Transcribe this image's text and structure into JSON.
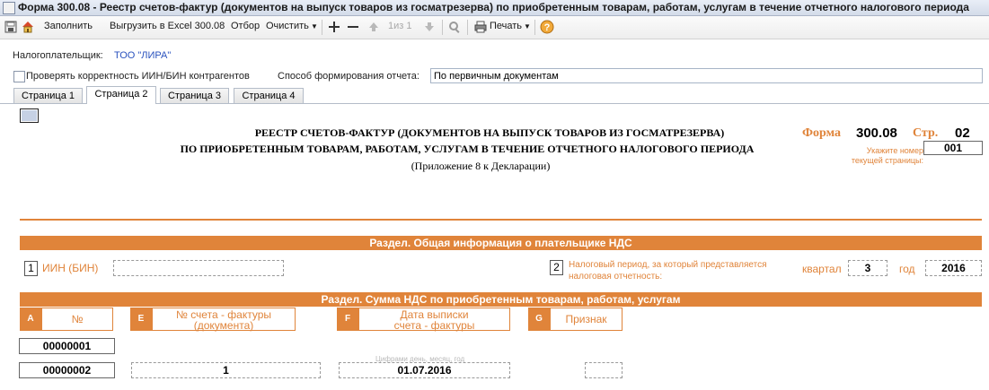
{
  "window": {
    "title": "Форма 300.08 - Реестр счетов-фактур (документов на выпуск товаров из госматрезерва) по приобретенным товарам, работам, услугам в течение отчетного налогового периода"
  },
  "toolbar": {
    "fill": "Заполнить",
    "export": "Выгрузить в Excel 300.08",
    "filter": "Отбор",
    "clear": "Очистить",
    "page_counter": "1из 1",
    "print": "Печать"
  },
  "header": {
    "taxpayer_label": "Налогоплательщик:",
    "taxpayer_value": "ТОО \"ЛИРА\"",
    "check_label": "Проверять корректность ИИН/БИН контрагентов",
    "method_label": "Способ формирования отчета:",
    "method_value": "По первичным документам"
  },
  "tabs": [
    "Страница 1",
    "Страница 2",
    "Страница 3",
    "Страница 4"
  ],
  "form": {
    "title_line1": "РЕЕСТР СЧЕТОВ-ФАКТУР (ДОКУМЕНТОВ НА ВЫПУСК ТОВАРОВ ИЗ ГОСМАТРЕЗЕРВА)",
    "title_line2": "ПО ПРИОБРЕТЕННЫМ ТОВАРАМ, РАБОТАМ, УСЛУГАМ В ТЕЧЕНИЕ ОТЧЕТНОГО НАЛОГОВОГО ПЕРИОДА",
    "title_line3": "(Приложение 8 к Декларации)",
    "form_label": "Форма",
    "form_number": "300.08",
    "page_label": "Стр.",
    "page_number": "02",
    "page_hint": "Укажите номер текущей страницы:",
    "current_page": "001",
    "section1_title": "Раздел. Общая информация о плательщике НДС",
    "field1_num": "1",
    "field1_label": "ИИН (БИН)",
    "field1_value": "",
    "field2_num": "2",
    "field2_label": "Налоговый период, за который представляется налоговая отчетность:",
    "quarter_label": "квартал",
    "quarter_value": "3",
    "year_label": "год",
    "year_value": "2016",
    "section2_title": "Раздел. Сумма НДС по приобретенным товарам, работам, услугам",
    "columns": [
      {
        "letter": "A",
        "label": "№"
      },
      {
        "letter": "E",
        "label": "№ счета - фактуры (документа)"
      },
      {
        "letter": "F",
        "label": "Дата выписки счета - фактуры"
      },
      {
        "letter": "G",
        "label": "Признак"
      }
    ],
    "date_hint": "Цифрами день, месяц, год",
    "rows": [
      {
        "num": "00000001",
        "invoice": "",
        "date": "",
        "sign": ""
      },
      {
        "num": "00000002",
        "invoice": "1",
        "date": "01.07.2016",
        "sign": ""
      }
    ]
  },
  "colors": {
    "accent": "#e0843a",
    "link": "#2a52be"
  }
}
